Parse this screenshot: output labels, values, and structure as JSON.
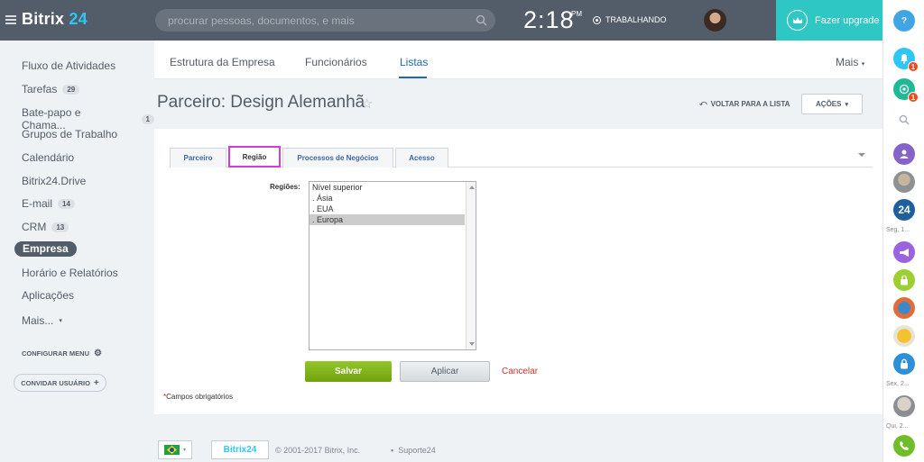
{
  "app": {
    "logo": "Bitrix",
    "logo_num": "24",
    "search_placeholder": "procurar pessoas, documentos, e mais",
    "clock": "2:18",
    "ampm": "PM",
    "work_status": "TRABALHANDO",
    "upgrade_label": "Fazer upgrade",
    "help_label": "?"
  },
  "sidebar": {
    "items": [
      {
        "label": "Fluxo de Atividades",
        "count": ""
      },
      {
        "label": "Tarefas",
        "count": "29"
      },
      {
        "label": "Bate-papo e Chama...",
        "count": "1"
      },
      {
        "label": "Grupos de Trabalho",
        "count": ""
      },
      {
        "label": "Calendário",
        "count": ""
      },
      {
        "label": "Bitrix24.Drive",
        "count": ""
      },
      {
        "label": "E-mail",
        "count": "14"
      },
      {
        "label": "CRM",
        "count": "13"
      },
      {
        "label": "Empresa",
        "count": ""
      },
      {
        "label": "Horário e Relatórios",
        "count": ""
      },
      {
        "label": "Aplicações",
        "count": ""
      },
      {
        "label": "Mais...",
        "count": ""
      }
    ],
    "configure": "CONFIGURAR MENU",
    "invite": "CONVIDAR USUÁRIO"
  },
  "topnav": {
    "tabs": [
      "Estrutura da Empresa",
      "Funcionários",
      "Listas"
    ],
    "active": "Listas",
    "more": "Mais"
  },
  "page": {
    "title": "Parceiro: Design Alemanhã",
    "back_label": "VOLTAR PARA A LISTA",
    "actions_label": "AÇÕES"
  },
  "form": {
    "tabs": [
      "Parceiro",
      "Região",
      "Processos de Negócios",
      "Acesso"
    ],
    "selected_tab": "Região",
    "field_label": "Regiões:",
    "options": [
      "Nível superior",
      ". Ásia",
      ". EUA",
      ". Europa"
    ],
    "selected_option": ". Europa",
    "save": "Salvar",
    "apply": "Aplicar",
    "cancel": "Cancelar",
    "required_mark": "*",
    "required_note": "Campos obrigatórios"
  },
  "footer": {
    "logo": "Bitrix24",
    "copyright": "© 2001-2017 Bitrix, Inc.",
    "support": "Suporte24"
  },
  "rightpanel": {
    "badges": [
      "1",
      "1"
    ],
    "logo24": "24",
    "labels": [
      "Seg, 1...",
      "Sex, 2...",
      "Qui, 2..."
    ]
  },
  "colors": {
    "topbar": "#535c69",
    "accent": "#2fc6f6",
    "upgrade": "#2fc7c4",
    "active_tab": "#2067b0",
    "save_button": "#7db31a",
    "highlight_tab_border": "#d63ad6"
  }
}
